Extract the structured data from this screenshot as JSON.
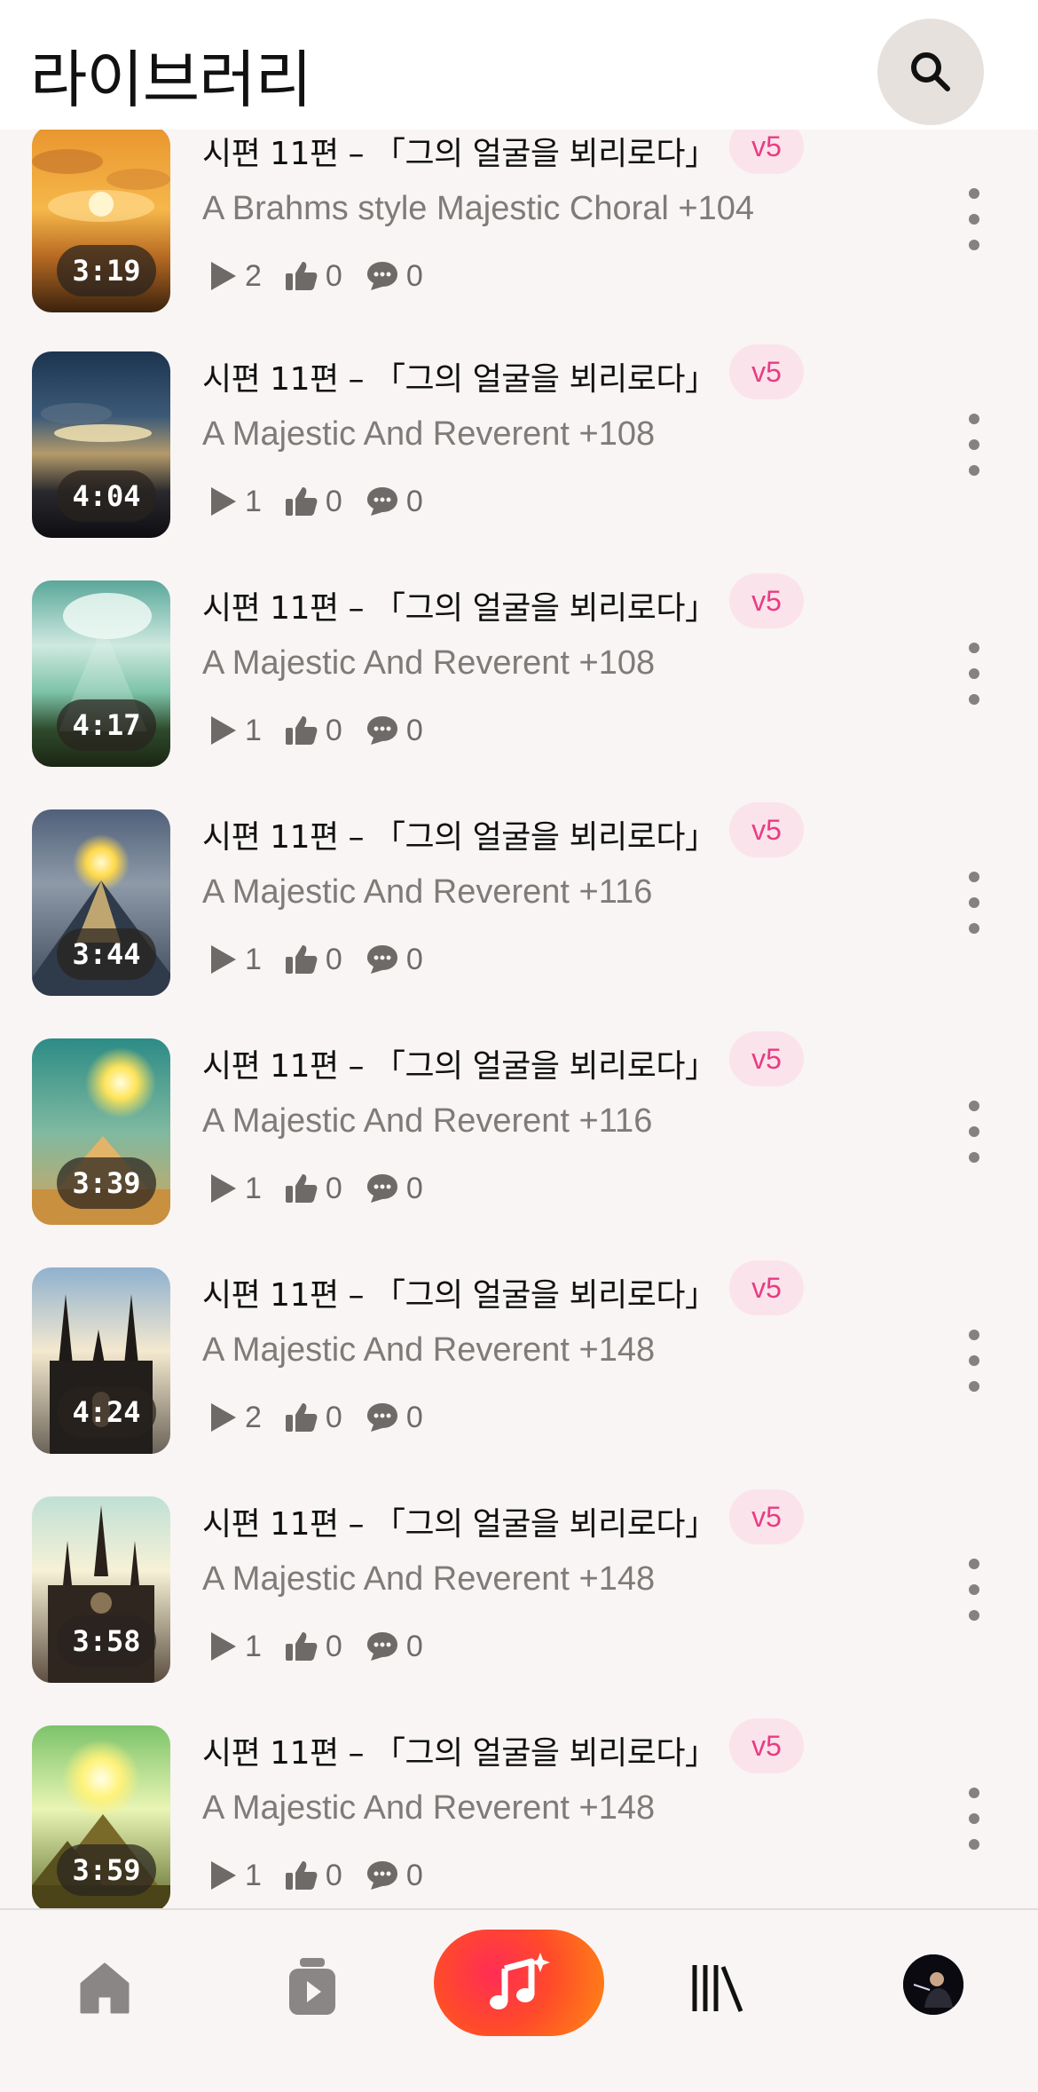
{
  "header": {
    "title": "라이브러리",
    "search_icon": "search-icon"
  },
  "tracks": [
    {
      "title": "시편 11편 – 「그의 얼굴을 뵈리로다」",
      "version": "v5",
      "style": "A Brahms style Majestic Choral +104",
      "duration": "3:19",
      "plays": "2",
      "likes": "0",
      "comments": "0",
      "artwork": "sunset over clouds"
    },
    {
      "title": "시편 11편 – 「그의 얼굴을 뵈리로다」",
      "version": "v5",
      "style": "A Majestic And Reverent +108",
      "duration": "4:04",
      "plays": "1",
      "likes": "0",
      "comments": "0",
      "artwork": "dark sky with glowing sun"
    },
    {
      "title": "시편 11편 – 「그의 얼굴을 뵈리로다」",
      "version": "v5",
      "style": "A Majestic And Reverent +108",
      "duration": "4:17",
      "plays": "1",
      "likes": "0",
      "comments": "0",
      "artwork": "light rays through clouds"
    },
    {
      "title": "시편 11편 – 「그의 얼굴을 뵈리로다」",
      "version": "v5",
      "style": "A Majestic And Reverent +116",
      "duration": "3:44",
      "plays": "1",
      "likes": "0",
      "comments": "0",
      "artwork": "sun above mountain peak"
    },
    {
      "title": "시편 11편 – 「그의 얼굴을 뵈리로다」",
      "version": "v5",
      "style": "A Majestic And Reverent +116",
      "duration": "3:39",
      "plays": "1",
      "likes": "0",
      "comments": "0",
      "artwork": "sun over desert mountain"
    },
    {
      "title": "시편 11편 – 「그의 얼굴을 뵈리로다」",
      "version": "v5",
      "style": "A Majestic And Reverent +148",
      "duration": "4:24",
      "plays": "2",
      "likes": "0",
      "comments": "0",
      "artwork": "gothic cathedral spires"
    },
    {
      "title": "시편 11편 – 「그의 얼굴을 뵈리로다」",
      "version": "v5",
      "style": "A Majestic And Reverent +148",
      "duration": "3:58",
      "plays": "1",
      "likes": "0",
      "comments": "0",
      "artwork": "cathedral with light rays"
    },
    {
      "title": "시편 11편 – 「그의 얼굴을 뵈리로다」",
      "version": "v5",
      "style": "A Majestic And Reverent +148",
      "duration": "3:59",
      "plays": "1",
      "likes": "0",
      "comments": "0",
      "artwork": "sun over green mountains"
    }
  ],
  "bottom_nav": {
    "items": [
      "home-icon",
      "feed-icon",
      "create-icon",
      "library-icon",
      "profile-avatar"
    ],
    "active": "library-icon",
    "accent": "#ff4a2a"
  },
  "colors": {
    "badge_bg": "#fbe3ec",
    "badge_text": "#e93c82",
    "secondary_text": "#7f7b79"
  }
}
